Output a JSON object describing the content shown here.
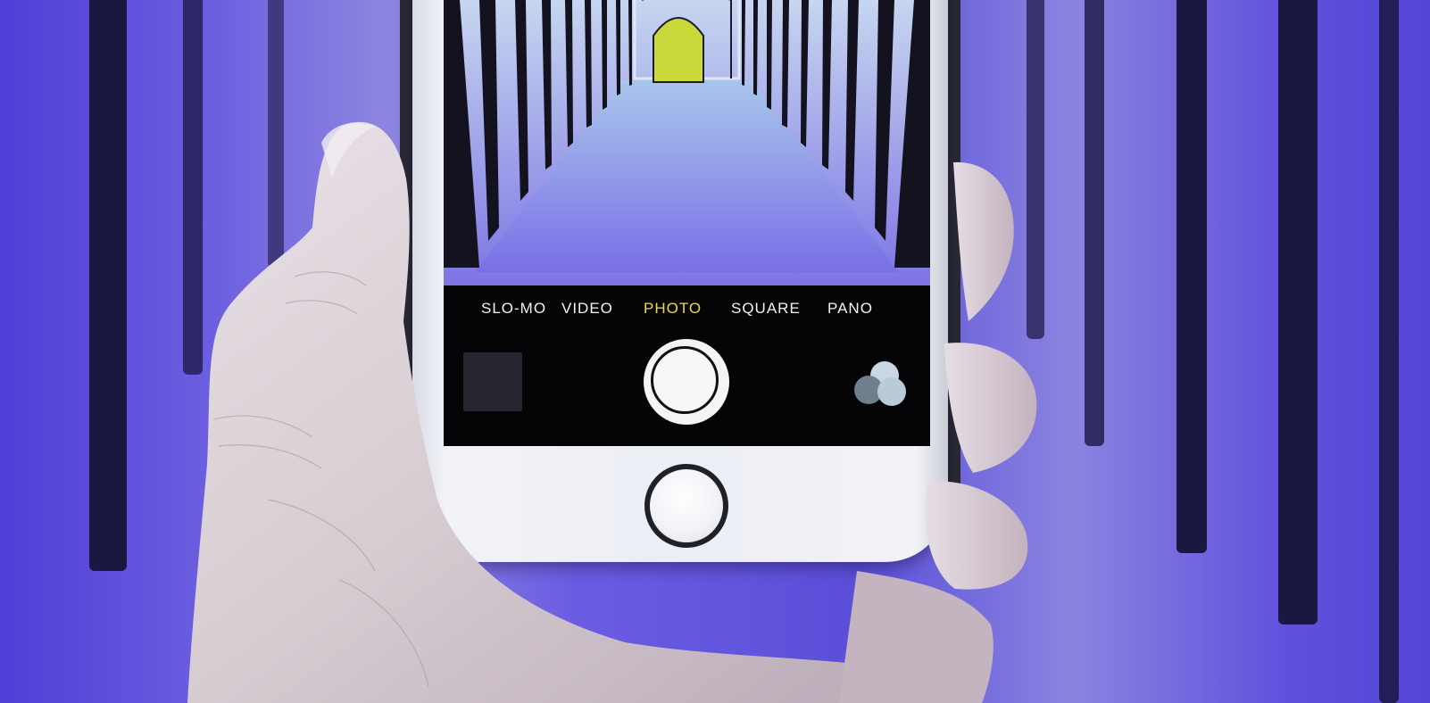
{
  "colors": {
    "background": "#5a4fd8",
    "stripe": "#1a1740",
    "phone_body": "#eceef5",
    "screen": "#050507",
    "active_mode": "#e6dc4a",
    "mode_text": "#f3f3f3",
    "skin": "#d9cfd2"
  },
  "camera": {
    "modes": [
      {
        "label": "SLO-MO",
        "active": false
      },
      {
        "label": "VIDEO",
        "active": false
      },
      {
        "label": "PHOTO",
        "active": true
      },
      {
        "label": "SQUARE",
        "active": false
      },
      {
        "label": "PANO",
        "active": false
      }
    ],
    "icons": {
      "shutter": "shutter-button-icon",
      "filters": "filters-icon",
      "last_photo": "photo-thumbnail-icon",
      "home": "home-button-icon"
    }
  }
}
